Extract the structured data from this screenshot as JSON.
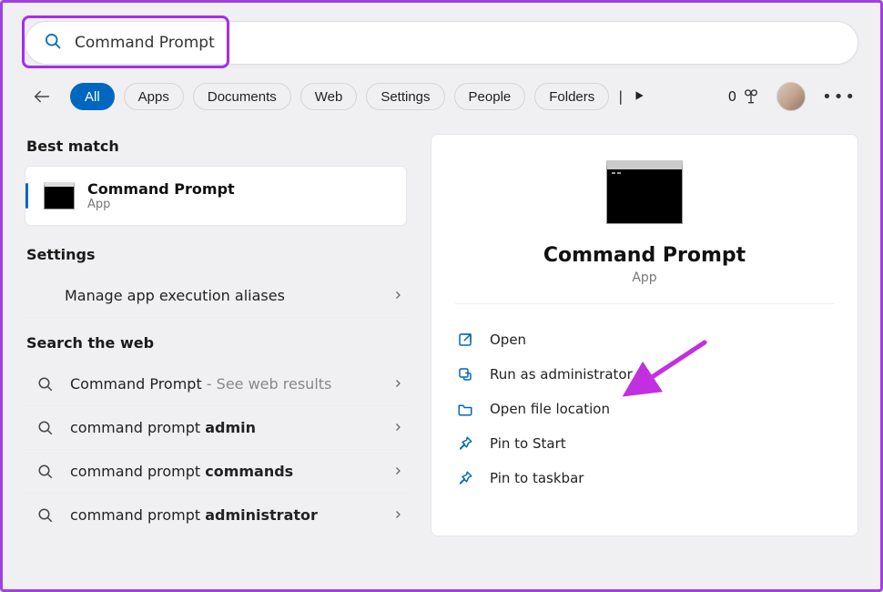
{
  "search": {
    "value": "Command Prompt"
  },
  "filters": {
    "items": [
      "All",
      "Apps",
      "Documents",
      "Web",
      "Settings",
      "People",
      "Folders"
    ],
    "active_index": 0,
    "rewards_count": "0"
  },
  "left": {
    "best_match_heading": "Best match",
    "best_match": {
      "title": "Command Prompt",
      "subtitle": "App"
    },
    "settings_heading": "Settings",
    "settings_item": "Manage app execution aliases",
    "web_heading": "Search the web",
    "web_items": [
      {
        "prefix": "Command Prompt",
        "suffix_light": " - See web results",
        "bold_tail": ""
      },
      {
        "prefix": "command prompt ",
        "suffix_light": "",
        "bold_tail": "admin"
      },
      {
        "prefix": "command prompt ",
        "suffix_light": "",
        "bold_tail": "commands"
      },
      {
        "prefix": "command prompt ",
        "suffix_light": "",
        "bold_tail": "administrator"
      }
    ]
  },
  "right": {
    "title": "Command Prompt",
    "subtitle": "App",
    "actions": [
      {
        "icon": "external",
        "label": "Open"
      },
      {
        "icon": "shield",
        "label": "Run as administrator"
      },
      {
        "icon": "folder",
        "label": "Open file location"
      },
      {
        "icon": "pin",
        "label": "Pin to Start"
      },
      {
        "icon": "pin",
        "label": "Pin to taskbar"
      }
    ]
  }
}
